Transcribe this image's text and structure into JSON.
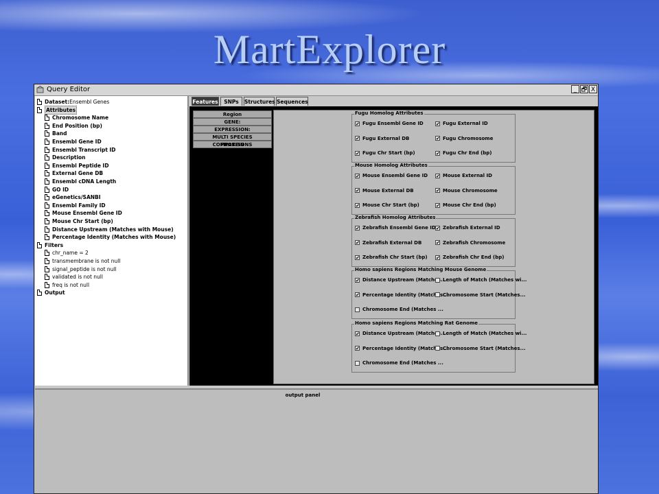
{
  "slide": {
    "title": "MartExplorer"
  },
  "window": {
    "title": "Query Editor",
    "buttons": [
      "_",
      "🗗",
      "X"
    ]
  },
  "tree": [
    {
      "label": "Dataset:",
      "value": " Ensembl Genes",
      "level": 0
    },
    {
      "label": "Attributes",
      "level": 0,
      "selected": true
    },
    {
      "label": "Chromosome Name",
      "level": 1
    },
    {
      "label": "End Position (bp)",
      "level": 1
    },
    {
      "label": "Band",
      "level": 1
    },
    {
      "label": "Ensembl Gene ID",
      "level": 1
    },
    {
      "label": "Ensembl Transcript ID",
      "level": 1
    },
    {
      "label": "Description",
      "level": 1
    },
    {
      "label": "Ensembl Peptide ID",
      "level": 1
    },
    {
      "label": "External Gene DB",
      "level": 1
    },
    {
      "label": "Ensembl cDNA Length",
      "level": 1
    },
    {
      "label": "GO ID",
      "level": 1
    },
    {
      "label": "eGenetics/SANBI",
      "level": 1
    },
    {
      "label": "Ensembl Family ID",
      "level": 1
    },
    {
      "label": "Mouse Ensembl Gene ID",
      "level": 1
    },
    {
      "label": "Mouse Chr Start (bp)",
      "level": 1
    },
    {
      "label": "Distance Upstream (Matches with Mouse)",
      "level": 1
    },
    {
      "label": "Percentage Identity (Matches with Mouse)",
      "level": 1
    },
    {
      "label": "Filters",
      "level": 0
    },
    {
      "label": "chr_name = 2",
      "level": 1,
      "plain": true
    },
    {
      "label": "transmembrane is not null",
      "level": 1,
      "plain": true
    },
    {
      "label": "signal_peptide is not null",
      "level": 1,
      "plain": true
    },
    {
      "label": "validated is not null",
      "level": 1,
      "plain": true
    },
    {
      "label": "freq is not null",
      "level": 1,
      "plain": true
    },
    {
      "label": "Output",
      "level": 0
    }
  ],
  "tabs": [
    "Features",
    "SNPs",
    "Structures",
    "Sequences"
  ],
  "side_items": [
    "Region",
    "GENE:",
    "EXPRESSION:",
    "MULTI SPECIES COMPARISONS",
    "PROTEIN"
  ],
  "groups": [
    {
      "title": "Fugu Homolog Attributes",
      "items": [
        {
          "label": "Fugu Ensembl Gene ID",
          "checked": true
        },
        {
          "label": "Fugu External ID",
          "checked": true
        },
        {
          "label": "Fugu External DB",
          "checked": true
        },
        {
          "label": "Fugu Chromosome",
          "checked": true
        },
        {
          "label": "Fugu Chr Start (bp)",
          "checked": true
        },
        {
          "label": "Fugu Chr End (bp)",
          "checked": true
        }
      ]
    },
    {
      "title": "Mouse Homolog Attributes",
      "items": [
        {
          "label": "Mouse Ensembl Gene ID",
          "checked": true
        },
        {
          "label": "Mouse External ID",
          "checked": true
        },
        {
          "label": "Mouse External DB",
          "checked": true
        },
        {
          "label": "Mouse Chromosome",
          "checked": true
        },
        {
          "label": "Mouse Chr Start (bp)",
          "checked": true
        },
        {
          "label": "Mouse Chr End (bp)",
          "checked": true
        }
      ]
    },
    {
      "title": "Zebrafish Homolog Attributes",
      "items": [
        {
          "label": "Zebrafish Ensembl Gene ID",
          "checked": true
        },
        {
          "label": "Zebrafish External ID",
          "checked": true
        },
        {
          "label": "Zebrafish External DB",
          "checked": true
        },
        {
          "label": "Zebrafish Chromosome",
          "checked": true
        },
        {
          "label": "Zebrafish Chr Start (bp)",
          "checked": true
        },
        {
          "label": "Zebrafish Chr End (bp)",
          "checked": true
        }
      ]
    },
    {
      "title": "Homo sapiens Regions Matching Mouse Genome",
      "items": [
        {
          "label": "Distance Upstream (Matches...",
          "checked": true
        },
        {
          "label": "Length of Match (Matches wi...",
          "checked": false
        },
        {
          "label": "Percentage Identity (Matches...",
          "checked": true
        },
        {
          "label": "Chromosome Start (Matches...",
          "checked": false
        },
        {
          "label": "Chromosome End (Matches ...",
          "checked": false
        }
      ]
    },
    {
      "title": "Homo sapiens Regions Matching Rat Genome",
      "items": [
        {
          "label": "Distance Upstream (Matches...",
          "checked": true
        },
        {
          "label": "Length of Match (Matches wi...",
          "checked": false
        },
        {
          "label": "Percentage Identity (Matches...",
          "checked": true
        },
        {
          "label": "Chromosome Start (Matches...",
          "checked": false
        },
        {
          "label": "Chromosome End (Matches ...",
          "checked": false
        }
      ]
    }
  ],
  "output": {
    "label": "output panel"
  }
}
